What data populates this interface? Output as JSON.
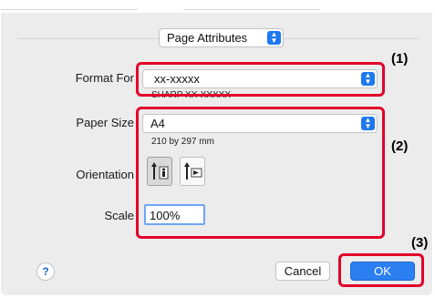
{
  "dialog": {
    "settings_popup": {
      "value": "Page Attributes"
    },
    "format_for": {
      "label": "Format For",
      "value": "xx-xxxxx",
      "subtext": "SHARP XX-XXXXX"
    },
    "paper_size": {
      "label": "Paper Size",
      "value": "A4",
      "subtext": "210 by 297 mm"
    },
    "orientation": {
      "label": "Orientation",
      "selected": "portrait"
    },
    "scale": {
      "label": "Scale",
      "value": "100%"
    },
    "buttons": {
      "help": "?",
      "cancel": "Cancel",
      "ok": "OK"
    }
  },
  "annotations": {
    "marker_1": "(1)",
    "marker_2": "(2)",
    "marker_3": "(3)"
  },
  "colors": {
    "accent": "#1e78f0",
    "highlight_box": "#e2002a"
  }
}
